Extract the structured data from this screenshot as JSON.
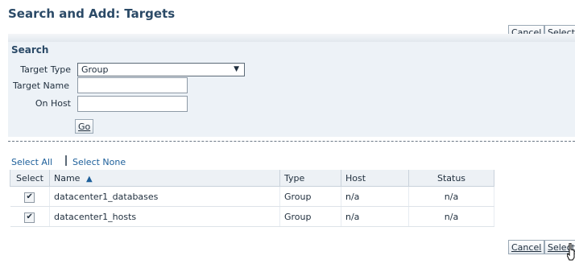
{
  "page": {
    "title": "Search and Add: Targets"
  },
  "buttons_top": {
    "cancel": "Cancel",
    "select": "Select"
  },
  "search": {
    "title": "Search",
    "target_type": {
      "label": "Target Type",
      "value": "Group",
      "arrow": "▼"
    },
    "target_name": {
      "label": "Target Name",
      "value": ""
    },
    "on_host": {
      "label": "On Host",
      "value": ""
    },
    "go": "Go"
  },
  "selection": {
    "select_all": "Select All",
    "select_none": "Select None"
  },
  "table": {
    "headers": {
      "select": "Select",
      "name": "Name",
      "sort_icon": "▲",
      "type": "Type",
      "host": "Host",
      "status": "Status"
    },
    "rows": [
      {
        "checked": true,
        "check_glyph": "✔",
        "name": "datacenter1_databases",
        "type": "Group",
        "host": "n/a",
        "status": "n/a"
      },
      {
        "checked": true,
        "check_glyph": "✔",
        "name": "datacenter1_hosts",
        "type": "Group",
        "host": "n/a",
        "status": "n/a"
      }
    ]
  },
  "buttons_bottom": {
    "cancel": "Cancel",
    "select": "Select"
  },
  "colors": {
    "title": "#2b4a67",
    "link": "#1d5f9a",
    "panel": "#edf2f7"
  }
}
